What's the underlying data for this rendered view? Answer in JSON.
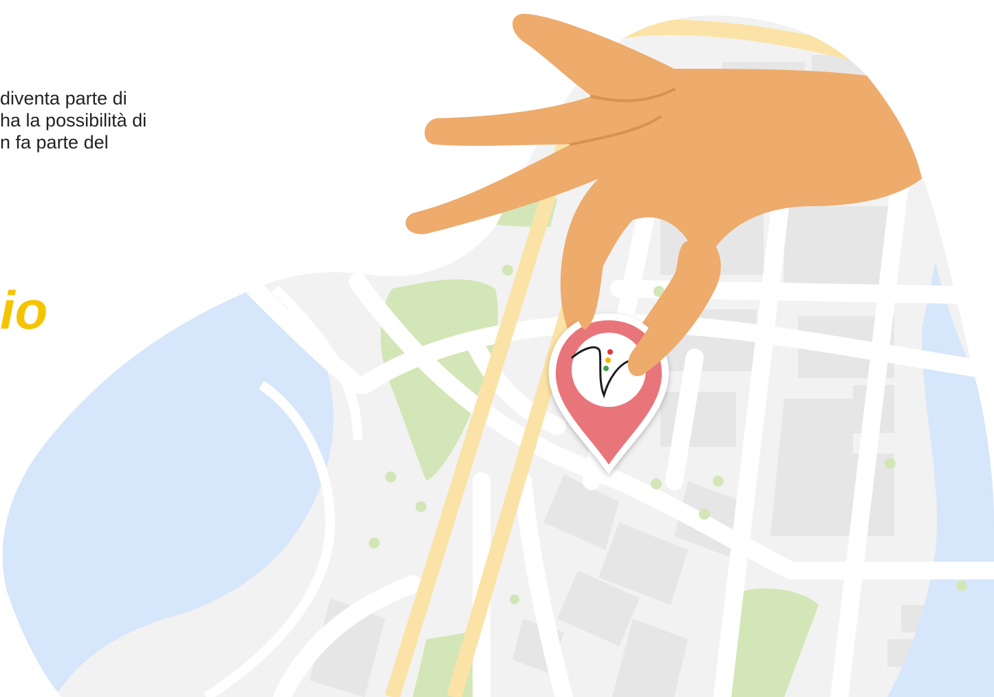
{
  "text_block": {
    "line_1": "diventa parte di",
    "line_2": "ha la possibilità di",
    "line_3": "n fa parte del"
  },
  "headline": {
    "text": "io"
  },
  "illustration": {
    "subject": "hand-placing-map-pin-on-city-map",
    "pin_logo": "traffic-light-v-logo",
    "colors": {
      "water": "#d6e6fb",
      "street": "#ffffff",
      "block": "#e8e8e8",
      "map_base": "#f2f2f2",
      "park": "#d3e6b7",
      "main_road": "#fbe3a7",
      "hand": "#edab6c",
      "pin": "#e8757a",
      "headline": "#f5c400"
    }
  }
}
